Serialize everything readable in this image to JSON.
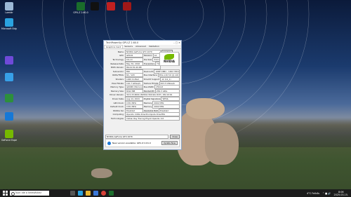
{
  "desktop": {
    "icons": [
      {
        "label": "Lomtár",
        "color": "#9bb8d6"
      },
      {
        "label": "Microsoft Edge",
        "color": "#2aa3e0"
      },
      {
        "label": "",
        "color": "#6f4ad8"
      },
      {
        "label": "",
        "color": "#37a0e8"
      },
      {
        "label": "",
        "color": "#2d8f3c"
      },
      {
        "label": "",
        "color": "#1678d6"
      },
      {
        "label": "GeForce Experience",
        "color": "#76b900"
      },
      {
        "label": "GPU-Z 2.60.0",
        "color": "#1a6d2b"
      },
      {
        "label": "",
        "color": "#111111"
      },
      {
        "label": "",
        "color": "#c02020"
      },
      {
        "label": "",
        "color": "#a01818"
      }
    ]
  },
  "gpuz": {
    "title": "TechPowerUp GPU-Z 2.60.0",
    "tabs": [
      "Graphics Card",
      "Sensors",
      "Advanced",
      "Validation"
    ],
    "rows": [
      {
        "k": "Name",
        "v": "NVIDIA GeForce GTX 1070",
        "btn": "Lookup"
      },
      {
        "k": "GPU",
        "v": "GP104",
        "k2": "Revision",
        "v2": "A1"
      },
      {
        "k": "Technology",
        "v": "16 nm",
        "k2": "Die Size",
        "v2": "314 mm²"
      },
      {
        "k": "Release Date",
        "v": "May 30, 2016",
        "k2": "Transistors",
        "v2": "7200M"
      },
      {
        "k": "BIOS Version",
        "v": "86.04.50.40.6B"
      },
      {
        "k": "Subvendor",
        "v": "MSI",
        "k2": "Device ID",
        "v2": "10DE 1B81 - 1462 3301"
      },
      {
        "k": "ROPs/TMUs",
        "v": "64 / 120",
        "k2": "Bus Interface",
        "v2": "PCIe x16 3.0 @ x16 3.0"
      },
      {
        "k": "Shaders",
        "v": "1920 Unified",
        "k2": "DirectX Support",
        "v2": "12 (12_1)"
      },
      {
        "k": "Pixel Fillrate",
        "v": "110.7 GPixel/s",
        "k2": "Texture Fillrate",
        "v2": "203.3 GTexel/s"
      },
      {
        "k": "Memory Type",
        "v": "GDDR5 (Micron)",
        "k2": "Bus Width",
        "v2": "256 bit"
      },
      {
        "k": "Memory Size",
        "v": "8192 MB",
        "k2": "Bandwidth",
        "v2": "256.3 GB/s"
      },
      {
        "k": "Driver Version",
        "v": "32.0.15.6094 (NVIDIA 560.94) DCH / Win10 64"
      },
      {
        "k": "Driver Date",
        "v": "Aug 14, 2024",
        "k2": "Digital Signature",
        "v2": "WHQL"
      },
      {
        "k": "GPU Clock",
        "v": "1531 MHz",
        "k2": "Memory",
        "v2": "2002 MHz"
      },
      {
        "k": "Default Clock",
        "v": "1531 MHz",
        "k2": "Memory",
        "v2": "2002 MHz"
      },
      {
        "k": "NVIDIA SLI",
        "v": "Disabled",
        "k2": "Resizable BAR",
        "v2": "Disabled"
      },
      {
        "k": "Computing",
        "v": "OpenCL  CUDA  DirectCompute  DirectML"
      },
      {
        "k": "Technologies",
        "v": "Vulkan  Ray Tracing  PhysX  OpenGL 4.6"
      }
    ],
    "device_select": "NVIDIA GeForce GTX 1070",
    "close_label": "Close",
    "banner_text": "New version available: GPU-Z 2.61.0",
    "banner_btn": "Update Now",
    "logo_text": "NVIDIA"
  },
  "taskbar": {
    "search_placeholder": "Írjon ide a kereséshez",
    "weather": "4°C  Felhős",
    "time": "8:06",
    "date": "2025.03.15."
  }
}
